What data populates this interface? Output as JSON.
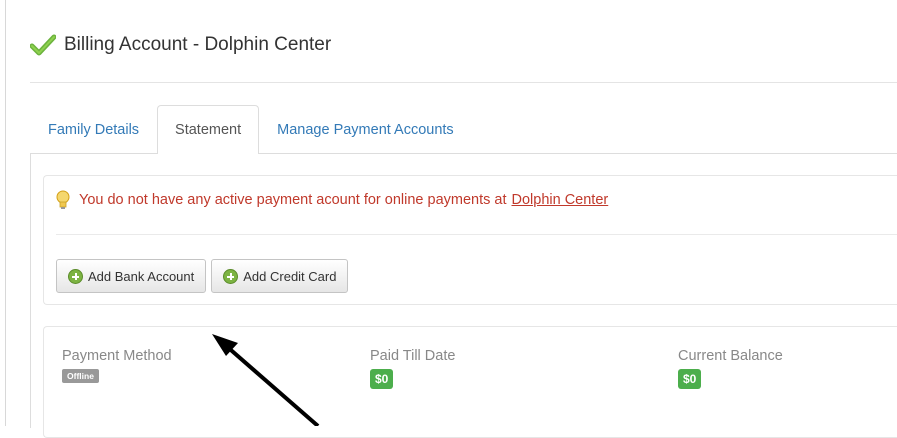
{
  "header": {
    "title": "Billing Account - Dolphin Center",
    "icon": "checkmark-icon",
    "icon_color": "#5cb85c"
  },
  "tabs": [
    {
      "label": "Family Details",
      "active": false
    },
    {
      "label": "Statement",
      "active": true
    },
    {
      "label": "Manage Payment Accounts",
      "active": false
    }
  ],
  "alert": {
    "icon": "lightbulb-icon",
    "message": "You do not have any active payment acount for online payments at",
    "link_text": "Dolphin Center",
    "color": "#c0392b"
  },
  "buttons": {
    "add_bank": "Add Bank Account",
    "add_card": "Add Credit Card"
  },
  "summary": {
    "payment_method": {
      "label": "Payment Method",
      "badge": "Offline"
    },
    "paid_till_date": {
      "label": "Paid Till Date",
      "value": "$0"
    },
    "current_balance": {
      "label": "Current Balance",
      "value": "$0"
    }
  },
  "colors": {
    "link": "#337ab7",
    "success_badge": "#4cae4c",
    "neutral_badge": "#999999"
  }
}
